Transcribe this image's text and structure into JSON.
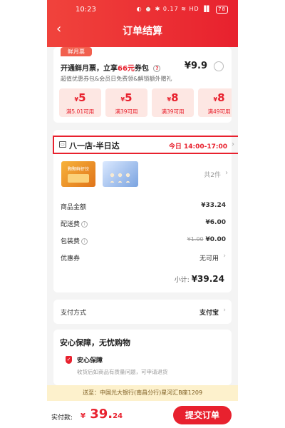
{
  "status_bar": {
    "time": "10:23",
    "icons_text": "◐ ⏰ ✱ 0.17 ≋ HD ▐▌",
    "battery": "78"
  },
  "header": {
    "title": "订单结算"
  },
  "fresh_card": {
    "tag": "鲜月票",
    "title_prefix": "开通鲜月票，立享",
    "title_highlight": "66元",
    "title_suffix": "券包",
    "price": "¥9.9",
    "subtitle": "超值优惠券包&会员日免费领&解锁额外赠礼",
    "coupons": [
      {
        "amount": "5",
        "condition": "满5.01可用"
      },
      {
        "amount": "5",
        "condition": "满39可用"
      },
      {
        "amount": "8",
        "condition": "满39可用"
      },
      {
        "amount": "8",
        "condition": "满49可用"
      }
    ]
  },
  "order": {
    "store_name": "八一店-半日达",
    "delivery_time": "今日 14:00-17:00",
    "product1_text": "颗颗鲜虾饺",
    "item_count": "共2件",
    "rows": [
      {
        "label": "商品金额",
        "value": "¥33.24"
      },
      {
        "label": "配送费",
        "value": "¥6.00"
      },
      {
        "label": "包装费",
        "original": "¥1.00",
        "value": "¥0.00"
      },
      {
        "label": "优惠券",
        "value": "无可用"
      }
    ],
    "subtotal_label": "小计:",
    "subtotal_value": "¥39.24"
  },
  "payment": {
    "label": "支付方式",
    "value": "支付宝"
  },
  "security": {
    "title": "安心保障，无忧购物",
    "subtitle": "安心保障",
    "description": "收货后如商品有质量问题，可申请退货"
  },
  "address_bar": {
    "text": "送至：中国光大银行(南昌分行)星河汇B座1209"
  },
  "footer": {
    "total_label": "实付款:",
    "currency": "¥",
    "total_int": "39.",
    "total_dec": "24",
    "submit_label": "提交订单"
  },
  "colors": {
    "accent": "#e8212e",
    "coupon_bg": "#fde7e3",
    "address_bg": "#fdf1cc"
  },
  "icons": [
    "back-arrow-icon",
    "question-icon",
    "radio-icon",
    "store-icon",
    "chevron-right-icon",
    "info-icon",
    "shield-icon"
  ]
}
